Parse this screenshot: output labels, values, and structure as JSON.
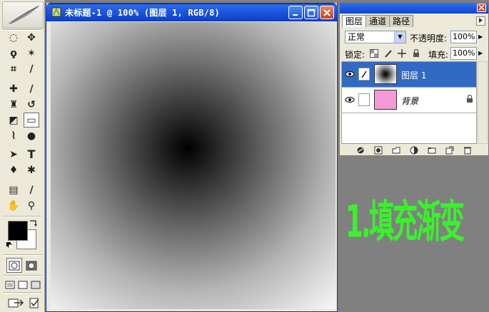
{
  "toolbox": {
    "tools": [
      {
        "name": "marquee-tool-icon",
        "glyph": "◌"
      },
      {
        "name": "move-tool-icon",
        "glyph": "✥"
      },
      {
        "name": "lasso-tool-icon",
        "glyph": "ϙ"
      },
      {
        "name": "magic-wand-tool-icon",
        "glyph": "✶"
      },
      {
        "name": "crop-tool-icon",
        "glyph": "⌗"
      },
      {
        "name": "slice-tool-icon",
        "glyph": "∕"
      },
      {
        "name": "healing-brush-tool-icon",
        "glyph": "✚"
      },
      {
        "name": "brush-tool-icon",
        "glyph": "∕"
      },
      {
        "name": "clone-stamp-tool-icon",
        "glyph": "♜"
      },
      {
        "name": "history-brush-tool-icon",
        "glyph": "↺"
      },
      {
        "name": "eraser-tool-icon",
        "glyph": "◩"
      },
      {
        "name": "gradient-tool-icon",
        "glyph": "▭"
      },
      {
        "name": "blur-tool-icon",
        "glyph": "⌇"
      },
      {
        "name": "dodge-tool-icon",
        "glyph": "●"
      },
      {
        "name": "path-selection-tool-icon",
        "glyph": "➤"
      },
      {
        "name": "type-tool-icon",
        "glyph": "T"
      },
      {
        "name": "pen-tool-icon",
        "glyph": "♦"
      },
      {
        "name": "custom-shape-tool-icon",
        "glyph": "✱"
      },
      {
        "name": "notes-tool-icon",
        "glyph": "▤"
      },
      {
        "name": "eyedropper-tool-icon",
        "glyph": "∕"
      },
      {
        "name": "hand-tool-icon",
        "glyph": "✋"
      },
      {
        "name": "zoom-tool-icon",
        "glyph": "⚲"
      }
    ],
    "foreground_color": "#000000",
    "background_color": "#ffffff"
  },
  "document": {
    "title": "未标题-1 @ 100% (图层 1, RGB/8)"
  },
  "layers_panel": {
    "tabs": [
      "图层",
      "通道",
      "路径"
    ],
    "blend_mode": "正常",
    "opacity_label": "不透明度:",
    "opacity_value": "100%",
    "lock_label": "锁定:",
    "fill_label": "填充:",
    "fill_value": "100%",
    "layers": [
      {
        "name": "图层 1",
        "selected": true,
        "thumbnail": "radial-gradient"
      },
      {
        "name": "背景",
        "selected": false,
        "thumbnail_color": "#f39ad6",
        "locked": true
      }
    ]
  },
  "caption": {
    "text": "1.填充渐变",
    "color": "#39f22c"
  }
}
